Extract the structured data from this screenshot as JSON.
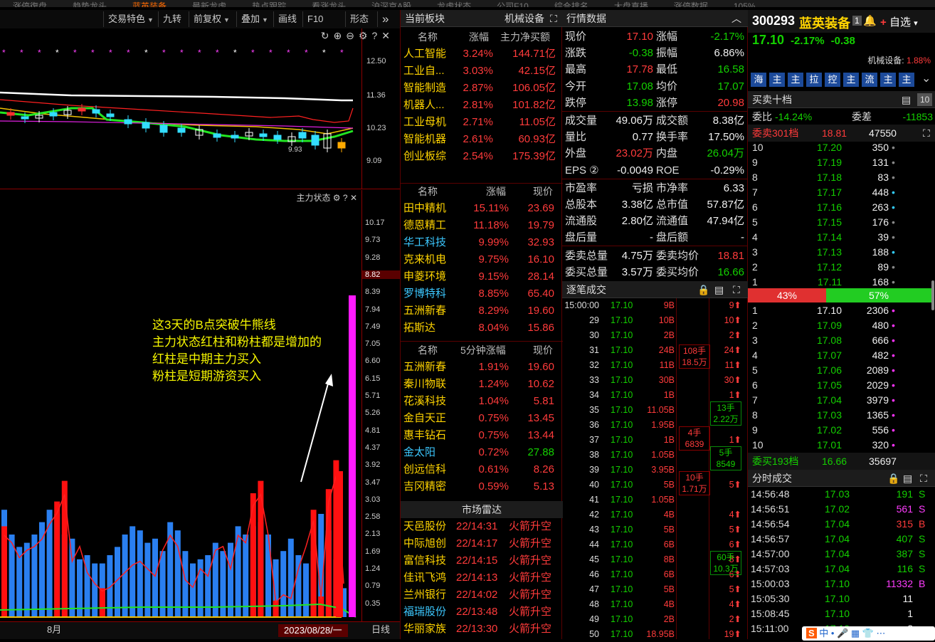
{
  "top_tabs": [
    "涨停復盘",
    "趋势龙头",
    "蓝英装备",
    "最新龙虎",
    "热点跟踪",
    "看涨龙头",
    "沪深京A股",
    "龙虎状态",
    "公司F10",
    "综合排名",
    "大盘直播",
    "涨停数据",
    "105%"
  ],
  "toolbar": {
    "items": [
      "交易特色",
      "九转",
      "前复权",
      "叠加",
      "画线",
      "F10",
      "形态"
    ],
    "more": "»"
  },
  "chart": {
    "price_ticks": [
      "12.50",
      "11.36",
      "10.23",
      "9.09"
    ],
    "low_label": "9.93",
    "indicator_title": "主力状态",
    "vol_ticks": [
      "10.17",
      "9.73",
      "9.28",
      "8.82",
      "8.39",
      "7.94",
      "7.49",
      "7.05",
      "6.60",
      "6.15",
      "5.71",
      "5.26",
      "4.81",
      "4.37",
      "3.92",
      "3.47",
      "3.03",
      "2.58",
      "2.13",
      "1.69",
      "1.24",
      "0.79",
      "0.35"
    ],
    "current_vol": "8.82",
    "date_axis": {
      "month": "8月",
      "current_date": "2023/08/28/一",
      "period": "日线"
    },
    "annotation": [
      "这3天的B点突破牛熊线",
      "主力状态红柱和粉柱都是增加的",
      "红柱是中期主力买入",
      "粉柱是短期游资买入"
    ],
    "main_state_red": [
      2.2,
      2.0,
      1.6,
      1.8,
      1.9,
      2.1,
      2.5,
      2.8,
      3.3,
      1.5,
      1.9,
      1.2,
      0.9,
      0.7,
      0.8,
      1.0,
      1.2,
      1.4,
      1.5,
      1.3,
      1.1,
      1.8,
      2.2,
      1.9,
      1.0,
      0.8,
      1.3,
      1.1,
      1.8,
      1.9,
      1.3,
      2.2,
      2.0,
      3.0,
      3.3,
      2.2,
      0.4,
      0.6,
      0.5,
      1.3,
      1.9,
      2.6,
      0.5,
      3.1,
      3.8,
      0.9
    ],
    "main_state_blue": [
      2.6,
      2.0,
      1.7,
      1.8,
      2.0,
      2.3,
      2.6,
      2.5,
      2.0,
      1.9,
      1.4,
      1.5,
      1.3,
      1.3,
      1.5,
      1.7,
      2.0,
      2.2,
      2.1,
      1.8,
      1.9,
      1.6,
      2.3,
      2.1,
      1.6,
      1.3,
      1.4,
      1.5,
      1.8,
      1.6,
      1.8,
      2.2,
      2.0,
      2.2,
      2.3,
      2.0,
      1.4,
      1.6,
      1.9,
      1.5,
      1.3,
      1.6,
      2.5,
      2.1,
      1.4,
      0.7
    ],
    "ma_colors": {
      "white": "#ffffff",
      "red": "#ff2020",
      "green": "#22e622",
      "yellow": "#f0c000",
      "magenta": "#e020e0"
    }
  },
  "sector": {
    "title": "当前板块",
    "tag": "机械设备",
    "headers": [
      "名称",
      "涨幅",
      "主力净买额"
    ],
    "rows": [
      [
        "人工智能",
        "3.24%",
        "144.71亿"
      ],
      [
        "工业自...",
        "3.03%",
        "42.15亿"
      ],
      [
        "智能制造",
        "2.87%",
        "106.05亿"
      ],
      [
        "机器人...",
        "2.81%",
        "101.82亿"
      ],
      [
        "工业母机",
        "2.71%",
        "11.05亿"
      ],
      [
        "智能机器",
        "2.61%",
        "60.93亿"
      ],
      [
        "创业板综",
        "2.54%",
        "175.39亿"
      ]
    ]
  },
  "peers": {
    "headers": [
      "名称",
      "涨幅",
      "现价"
    ],
    "rows": [
      [
        "田中精机",
        "15.11%",
        "23.69",
        "#ffd400"
      ],
      [
        "德恩精工",
        "11.18%",
        "19.79",
        "#ffd400"
      ],
      [
        "华工科技",
        "9.99%",
        "32.93",
        "#3cc8ff"
      ],
      [
        "克来机电",
        "9.75%",
        "16.10",
        "#ffd400"
      ],
      [
        "申菱环境",
        "9.15%",
        "28.14",
        "#ffd400"
      ],
      [
        "罗博特科",
        "8.85%",
        "65.40",
        "#3cc8ff"
      ],
      [
        "五洲新春",
        "8.29%",
        "19.60",
        "#ffd400"
      ],
      [
        "拓斯达",
        "8.04%",
        "15.86",
        "#ffd400"
      ]
    ]
  },
  "five_min": {
    "headers": [
      "名称",
      "5分钟涨幅",
      "现价"
    ],
    "rows": [
      [
        "五洲新春",
        "1.91%",
        "19.60",
        "#ffd400"
      ],
      [
        "秦川物联",
        "1.24%",
        "10.62",
        "#ffd400"
      ],
      [
        "花溪科技",
        "1.04%",
        "5.81",
        "#ffd400"
      ],
      [
        "金自天正",
        "0.75%",
        "13.45",
        "#ffd400"
      ],
      [
        "惠丰钻石",
        "0.75%",
        "13.44",
        "#ffd400"
      ],
      [
        "金太阳",
        "0.72%",
        "27.88",
        "#3cc8ff",
        "grn"
      ],
      [
        "创远信科",
        "0.61%",
        "8.26",
        "#ffd400"
      ],
      [
        "吉冈精密",
        "0.59%",
        "5.13",
        "#ffd400"
      ]
    ]
  },
  "radar": {
    "title": "市场雷达",
    "rows": [
      [
        "天邑股份",
        "22/14:31",
        "火箭升空",
        "#ffd400"
      ],
      [
        "中际旭创",
        "22/14:17",
        "火箭升空",
        "#ffd400"
      ],
      [
        "富信科技",
        "22/14:15",
        "火箭升空",
        "#ffd400"
      ],
      [
        "佳讯飞鸿",
        "22/14:13",
        "火箭升空",
        "#ffd400"
      ],
      [
        "兰州银行",
        "22/14:02",
        "火箭升空",
        "#ffd400"
      ],
      [
        "福瑞股份",
        "22/13:48",
        "火箭升空",
        "#3cc8ff"
      ],
      [
        "华丽家族",
        "22/13:30",
        "火箭升空",
        "#ffd400"
      ]
    ]
  },
  "quote": {
    "title": "行情数据",
    "rows": [
      [
        "现价",
        "17.10",
        "red",
        "涨幅",
        "-2.17%",
        "grn"
      ],
      [
        "涨跌",
        "-0.38",
        "grn",
        "振幅",
        "6.86%",
        "wht"
      ],
      [
        "最高",
        "17.78",
        "red",
        "最低",
        "16.58",
        "grn"
      ],
      [
        "今开",
        "17.08",
        "grn",
        "均价",
        "17.07",
        "grn"
      ],
      [
        "跌停",
        "13.98",
        "grn",
        "涨停",
        "20.98",
        "red"
      ],
      [
        "成交量",
        "49.06万",
        "wht",
        "成交额",
        "8.38亿",
        "wht"
      ],
      [
        "量比",
        "0.77",
        "wht",
        "换手率",
        "17.50%",
        "wht"
      ],
      [
        "外盘",
        "23.02万",
        "red",
        "内盘",
        "26.04万",
        "grn"
      ],
      [
        "EPS ②",
        "-0.0049",
        "wht",
        "ROE",
        "-0.29%",
        "wht"
      ],
      [
        "市盈率",
        "亏损",
        "wht",
        "市净率",
        "6.33",
        "wht"
      ],
      [
        "总股本",
        "3.38亿",
        "wht",
        "总市值",
        "57.87亿",
        "wht"
      ],
      [
        "流通股",
        "2.80亿",
        "wht",
        "流通值",
        "47.94亿",
        "wht"
      ],
      [
        "盘后量",
        "-",
        "wht",
        "盘后额",
        "-",
        "wht"
      ],
      [
        "委卖总量",
        "4.75万",
        "wht",
        "委卖均价",
        "18.81",
        "red"
      ],
      [
        "委买总量",
        "3.57万",
        "wht",
        "委买均价",
        "16.66",
        "grn"
      ]
    ]
  },
  "ticks": {
    "title": "逐笔成交",
    "rows": [
      [
        "15:00:00",
        "17.10",
        "9B",
        "9"
      ],
      [
        "29",
        "17.10",
        "10B",
        "10"
      ],
      [
        "30",
        "17.10",
        "2B",
        "2"
      ],
      [
        "31",
        "17.10",
        "24B",
        "24"
      ],
      [
        "32",
        "17.10",
        "11B",
        "11"
      ],
      [
        "33",
        "17.10",
        "30B",
        "30"
      ],
      [
        "34",
        "17.10",
        "1B",
        "1"
      ],
      [
        "35",
        "17.10",
        "11.05B",
        ""
      ],
      [
        "36",
        "17.10",
        "1.95B",
        ""
      ],
      [
        "37",
        "17.10",
        "1B",
        "1"
      ],
      [
        "38",
        "17.10",
        "1.05B",
        ""
      ],
      [
        "39",
        "17.10",
        "3.95B",
        ""
      ],
      [
        "40",
        "17.10",
        "5B",
        "5"
      ],
      [
        "41",
        "17.10",
        "1.05B",
        ""
      ],
      [
        "42",
        "17.10",
        "4B",
        "4"
      ],
      [
        "43",
        "17.10",
        "5B",
        "5"
      ],
      [
        "44",
        "17.10",
        "6B",
        "6"
      ],
      [
        "45",
        "17.10",
        "8B",
        "8"
      ],
      [
        "46",
        "17.10",
        "6B",
        "6"
      ],
      [
        "47",
        "17.10",
        "5B",
        "5"
      ],
      [
        "48",
        "17.10",
        "4B",
        "4"
      ],
      [
        "49",
        "17.10",
        "2B",
        "2"
      ],
      [
        "50",
        "17.10",
        "18.95B",
        "19"
      ]
    ],
    "groups": [
      [
        "108手",
        "18.5万"
      ],
      [
        "4手",
        "6839"
      ],
      [
        "10手",
        "1.71万"
      ],
      [
        "13手",
        "2.22万"
      ],
      [
        "5手",
        "8549"
      ],
      [
        "60手",
        "10.3万"
      ]
    ]
  },
  "stock": {
    "code": "300293",
    "name": "蓝英装备",
    "badge": "1",
    "fav": "自选",
    "price": "17.10",
    "pct": "-2.17%",
    "chg": "-0.38",
    "industry": "机械设备:",
    "industry_pct": "1.88%",
    "tabs": [
      "海",
      "主",
      "主",
      "拉",
      "控",
      "主",
      "流",
      "主",
      "主"
    ]
  },
  "orderbook": {
    "title": "买卖十档",
    "weibi_label": "委比",
    "weibi": "-14.24%",
    "weicha_label": "委差",
    "weicha": "-11853",
    "sell_head": "委卖301档",
    "sell_avg": "18.81",
    "sell_total": "47550",
    "buy_head": "委买193档",
    "buy_avg": "16.66",
    "buy_total": "35697",
    "sell_pct": "43%",
    "buy_pct": "57%",
    "sells": [
      [
        "10",
        "17.20",
        "350",
        "#888"
      ],
      [
        "9",
        "17.19",
        "131",
        "#888"
      ],
      [
        "8",
        "17.18",
        "83",
        "#888"
      ],
      [
        "7",
        "17.17",
        "448",
        "#3cf"
      ],
      [
        "6",
        "17.16",
        "263",
        "#3cf"
      ],
      [
        "5",
        "17.15",
        "176",
        "#888"
      ],
      [
        "4",
        "17.14",
        "39",
        "#888"
      ],
      [
        "3",
        "17.13",
        "188",
        "#3cf"
      ],
      [
        "2",
        "17.12",
        "89",
        "#888"
      ],
      [
        "1",
        "17.11",
        "168",
        "#888"
      ]
    ],
    "buys": [
      [
        "1",
        "17.10",
        "2306",
        "#f3f"
      ],
      [
        "2",
        "17.09",
        "480",
        "#f3f"
      ],
      [
        "3",
        "17.08",
        "666",
        "#f3f"
      ],
      [
        "4",
        "17.07",
        "482",
        "#f3f"
      ],
      [
        "5",
        "17.06",
        "2089",
        "#f3f"
      ],
      [
        "6",
        "17.05",
        "2029",
        "#f3f"
      ],
      [
        "7",
        "17.04",
        "3979",
        "#f3f"
      ],
      [
        "8",
        "17.03",
        "1365",
        "#f3f"
      ],
      [
        "9",
        "17.02",
        "556",
        "#f3f"
      ],
      [
        "10",
        "17.01",
        "320",
        "#f3f"
      ]
    ]
  },
  "timesales": {
    "title": "分时成交",
    "rows": [
      [
        "14:56:48",
        "17.03",
        "191",
        "S",
        "grn"
      ],
      [
        "14:56:51",
        "17.02",
        "561",
        "S",
        "mag"
      ],
      [
        "14:56:54",
        "17.04",
        "315",
        "B",
        "red"
      ],
      [
        "14:56:57",
        "17.04",
        "407",
        "S",
        "grn"
      ],
      [
        "14:57:00",
        "17.04",
        "387",
        "S",
        "grn"
      ],
      [
        "14:57:03",
        "17.04",
        "116",
        "S",
        "grn"
      ],
      [
        "15:00:03",
        "17.10",
        "11332",
        "B",
        "mag"
      ],
      [
        "15:05:30",
        "17.10",
        "11",
        "",
        ""
      ],
      [
        "15:08:45",
        "17.10",
        "1",
        "",
        ""
      ],
      [
        "15:11:00",
        "17.10",
        "2",
        "",
        ""
      ]
    ]
  }
}
